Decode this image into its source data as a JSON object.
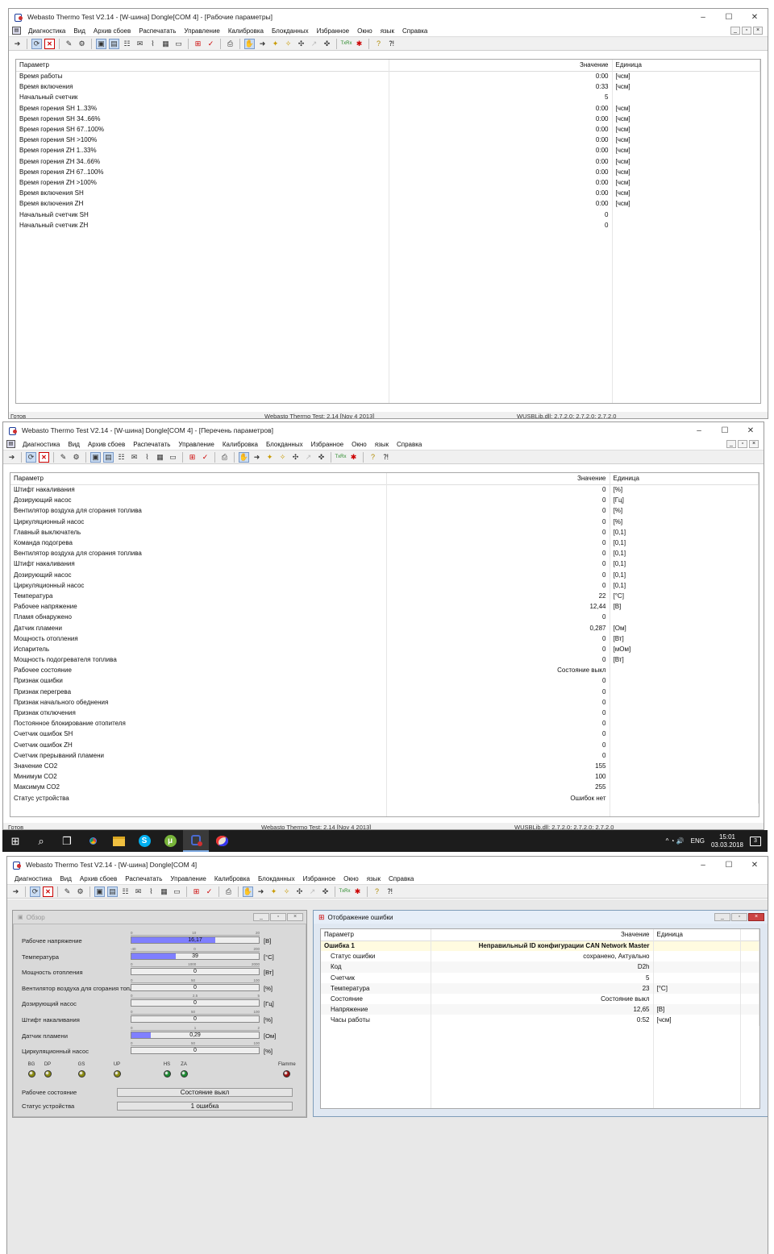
{
  "menu": [
    "Диагностика",
    "Вид",
    "Архив сбоев",
    "Распечатать",
    "Управление",
    "Калибровка",
    "Блокданных",
    "Избранное",
    "Окно",
    "язык",
    "Справка"
  ],
  "controls": {
    "minimize": "–",
    "maximize": "☐",
    "close": "✕",
    "mdi_min": "_",
    "mdi_restore": "▫",
    "mdi_close": "×"
  },
  "win1": {
    "title": "Webasto Thermo Test V2.14 - [W-шина] Dongle[COM 4] - [Рабочие параметры]",
    "headers": {
      "param": "Параметр",
      "value": "Значение",
      "unit": "Единица"
    },
    "rows": [
      [
        "Время работы",
        "0:00",
        "[чсм]"
      ],
      [
        "Время включения",
        "0:33",
        "[чсм]"
      ],
      [
        "Начальный счетчик",
        "5",
        ""
      ],
      [
        "Время горения SH 1..33%",
        "0:00",
        "[чсм]"
      ],
      [
        "Время горения SH 34..66%",
        "0:00",
        "[чсм]"
      ],
      [
        "Время горения SH 67..100%",
        "0:00",
        "[чсм]"
      ],
      [
        "Время горения SH >100%",
        "0:00",
        "[чсм]"
      ],
      [
        "Время горения ZH 1..33%",
        "0:00",
        "[чсм]"
      ],
      [
        "Время горения ZH 34..66%",
        "0:00",
        "[чсм]"
      ],
      [
        "Время горения ZH 67..100%",
        "0:00",
        "[чсм]"
      ],
      [
        "Время горения ZH >100%",
        "0:00",
        "[чсм]"
      ],
      [
        "Время включения SH",
        "0:00",
        "[чсм]"
      ],
      [
        "Время включения ZH",
        "0:00",
        "[чсм]"
      ],
      [
        "Начальный счетчик SH",
        "0",
        ""
      ],
      [
        "Начальный счетчик ZH",
        "0",
        ""
      ]
    ],
    "status": [
      "Готов",
      "Webasto Thermo Test: 2.14 [Nov 4 2013]",
      "WUSBLib.dll: 2.7.2.0; 2.7.2.0; 2.7.2.0"
    ]
  },
  "win2": {
    "title": "Webasto Thermo Test V2.14 - [W-шина] Dongle[COM 4] - [Перечень параметров]",
    "headers": {
      "param": "Параметр",
      "value": "Значение",
      "unit": "Единица"
    },
    "rows": [
      [
        "Штифт накаливания",
        "0",
        "[%]"
      ],
      [
        "Дозирующий насос",
        "0",
        "[Гц]"
      ],
      [
        "Вентилятор воздуха для сгорания топлива",
        "0",
        "[%]"
      ],
      [
        "Циркуляционный насос",
        "0",
        "[%]"
      ],
      [
        "Главный выключатель",
        "0",
        "[0,1]"
      ],
      [
        "Команда подогрева",
        "0",
        "[0,1]"
      ],
      [
        "Вентилятор воздуха для сгорания топлива",
        "0",
        "[0,1]"
      ],
      [
        "Штифт накаливания",
        "0",
        "[0,1]"
      ],
      [
        "Дозирующий насос",
        "0",
        "[0,1]"
      ],
      [
        "Циркуляционный насос",
        "0",
        "[0,1]"
      ],
      [
        "Температура",
        "22",
        "[°C]"
      ],
      [
        "Рабочее напряжение",
        "12,44",
        "[В]"
      ],
      [
        "Пламя обнаружено",
        "0",
        ""
      ],
      [
        "Датчик пламени",
        "0,287",
        "[Ом]"
      ],
      [
        "Мощность отопления",
        "0",
        "[Вт]"
      ],
      [
        "Испаритель",
        "0",
        "[мОм]"
      ],
      [
        "Мощность подогревателя топлива",
        "0",
        "[Вт]"
      ],
      [
        "Рабочее состояние",
        "Состояние выкл",
        ""
      ],
      [
        "Признак ошибки",
        "0",
        ""
      ],
      [
        "Признак перегрева",
        "0",
        ""
      ],
      [
        "Признак начального обеднения",
        "0",
        ""
      ],
      [
        "Признак отключения",
        "0",
        ""
      ],
      [
        "Постоянное блокирование отопителя",
        "0",
        ""
      ],
      [
        "Счетчик ошибок SH",
        "0",
        ""
      ],
      [
        "Счетчик ошибок ZH",
        "0",
        ""
      ],
      [
        "Счетчик прерываний пламени",
        "0",
        ""
      ],
      [
        "Значение CO2",
        "155",
        ""
      ],
      [
        "Минимум CO2",
        "100",
        ""
      ],
      [
        "Максимум CO2",
        "255",
        ""
      ],
      [
        "Статус устройства",
        "Ошибок нет",
        ""
      ]
    ],
    "status": [
      "Готов",
      "Webasto Thermo Test: 2.14 [Nov 4 2013]",
      "WUSBLib.dll: 2.7.2.0; 2.7.2.0; 2.7.2.0"
    ]
  },
  "taskbar": {
    "start": "⊞",
    "search": "⌕",
    "taskview": "❐",
    "apps": [
      "Chrome",
      "Проводник",
      "Skype",
      "uTorrent",
      "Webasto",
      "Paint"
    ],
    "lang": "ENG",
    "time": "15:01",
    "date": "03.03.2018",
    "notif": "3",
    "tray_icons": "^ ◔ 🔊"
  },
  "win3": {
    "title": "Webasto Thermo Test V2.14 - [W-шина] Dongle[COM 4]",
    "overview": {
      "title": "Обзор",
      "gauges": [
        {
          "label": "Рабочее напряжение",
          "value": "16,17",
          "unit": "[В]",
          "fill": 0.66,
          "scale": [
            "0",
            "10",
            "20"
          ]
        },
        {
          "label": "Температура",
          "value": "39",
          "unit": "[°C]",
          "fill": 0.35,
          "scale": [
            "-40",
            "0",
            "200"
          ]
        },
        {
          "label": "Мощность отопления",
          "value": "0",
          "unit": "[Вт]",
          "fill": 0,
          "scale": [
            "0",
            "1000",
            "2000"
          ]
        },
        {
          "label": "Вентилятор воздуха для сгорания топлива",
          "value": "0",
          "unit": "[%]",
          "fill": 0,
          "scale": [
            "0",
            "50",
            "100"
          ]
        },
        {
          "label": "Дозирующий насос",
          "value": "0",
          "unit": "[Гц]",
          "fill": 0,
          "scale": [
            "0",
            "2.5",
            "5"
          ]
        },
        {
          "label": "Штифт накаливания",
          "value": "0",
          "unit": "[%]",
          "fill": 0,
          "scale": [
            "0",
            "50",
            "100"
          ]
        },
        {
          "label": "Датчик пламени",
          "value": "0,29",
          "unit": "[Ом]",
          "fill": 0.15,
          "scale": [
            "0",
            "1",
            "2"
          ]
        },
        {
          "label": "Циркуляционный насос",
          "value": "0",
          "unit": "[%]",
          "fill": 0,
          "scale": [
            "0",
            "50",
            "100"
          ]
        }
      ],
      "leds": [
        {
          "label": "BG",
          "color": "#8a8a10"
        },
        {
          "label": "DP",
          "color": "#8a8a10"
        },
        {
          "label": "GS",
          "color": "#8a8a10"
        },
        {
          "label": "UP",
          "color": "#8a8a10"
        },
        {
          "label": "HS",
          "color": "#1a8a30"
        },
        {
          "label": "ZA",
          "color": "#1a8a30"
        },
        {
          "label": "Flamme",
          "color": "#9a1010"
        }
      ],
      "state_label": "Рабочее состояние",
      "state_value": "Состояние выкл",
      "status_label": "Статус устройства",
      "status_value": "1 ошибка"
    },
    "errors": {
      "title": "Отображение ошибки",
      "headers": {
        "param": "Параметр",
        "value": "Значение",
        "unit": "Единица"
      },
      "error_name": "Ошибка 1",
      "error_desc": "Неправильный ID конфигурации CAN Network Master",
      "rows": [
        [
          "Статус ошибки",
          "сохранено, Актуально",
          ""
        ],
        [
          "Код",
          "D2h",
          ""
        ],
        [
          "Счетчик",
          "5",
          ""
        ],
        [
          "Температура",
          "23",
          "[°C]"
        ],
        [
          "Состояние",
          "Состояние выкл",
          ""
        ],
        [
          "Напряжение",
          "12,65",
          "[В]"
        ],
        [
          "Часы работы",
          "0:52",
          "[чсм]"
        ]
      ]
    }
  }
}
